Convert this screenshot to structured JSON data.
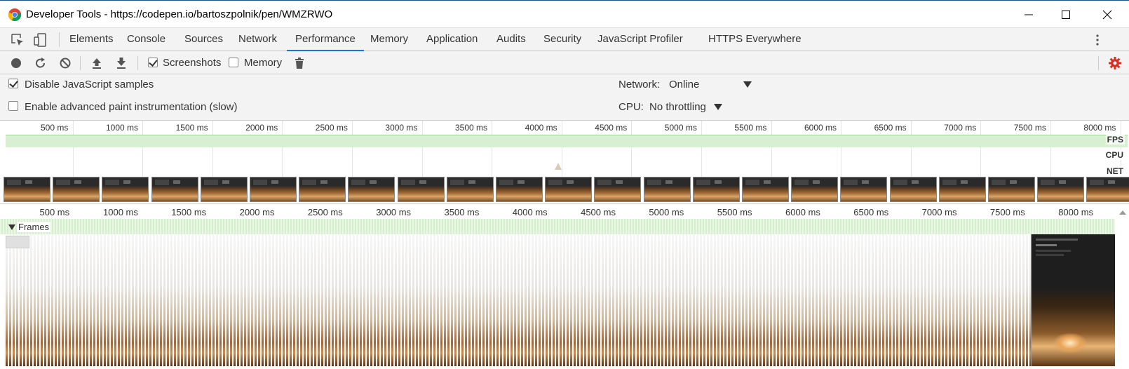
{
  "window": {
    "title": "Developer Tools - https://codepen.io/bartoszpolnik/pen/WMZRWO"
  },
  "tabs": [
    {
      "label": "Elements"
    },
    {
      "label": "Console"
    },
    {
      "label": "Sources"
    },
    {
      "label": "Network"
    },
    {
      "label": "Performance",
      "active": true
    },
    {
      "label": "Memory"
    },
    {
      "label": "Application"
    },
    {
      "label": "Audits"
    },
    {
      "label": "Security"
    },
    {
      "label": "JavaScript Profiler"
    },
    {
      "label": "HTTPS Everywhere"
    }
  ],
  "toolbar": {
    "screenshots_label": "Screenshots",
    "screenshots_checked": true,
    "memory_label": "Memory",
    "memory_checked": false
  },
  "settings": {
    "disable_js_samples_label": "Disable JavaScript samples",
    "disable_js_samples_checked": true,
    "advanced_paint_label": "Enable advanced paint instrumentation (slow)",
    "advanced_paint_checked": false,
    "network_label": "Network:",
    "network_value": "Online",
    "cpu_label": "CPU:",
    "cpu_value": "No throttling"
  },
  "overview": {
    "tick_labels": [
      "500 ms",
      "1000 ms",
      "1500 ms",
      "2000 ms",
      "2500 ms",
      "3000 ms",
      "3500 ms",
      "4000 ms",
      "4500 ms",
      "5000 ms",
      "5500 ms",
      "6000 ms",
      "6500 ms",
      "7000 ms",
      "7500 ms",
      "8000 ms"
    ],
    "lanes": [
      "FPS",
      "CPU",
      "NET"
    ]
  },
  "main": {
    "tick_labels": [
      "500 ms",
      "1000 ms",
      "1500 ms",
      "2000 ms",
      "2500 ms",
      "3000 ms",
      "3500 ms",
      "4000 ms",
      "4500 ms",
      "5000 ms",
      "5500 ms",
      "6000 ms",
      "6500 ms",
      "7000 ms",
      "7500 ms",
      "8000 ms"
    ],
    "frames_label": "Frames"
  },
  "colors": {
    "accent": "#1a73e8",
    "fps_green": "#d7f0d1",
    "settings_red": "#d93025"
  }
}
